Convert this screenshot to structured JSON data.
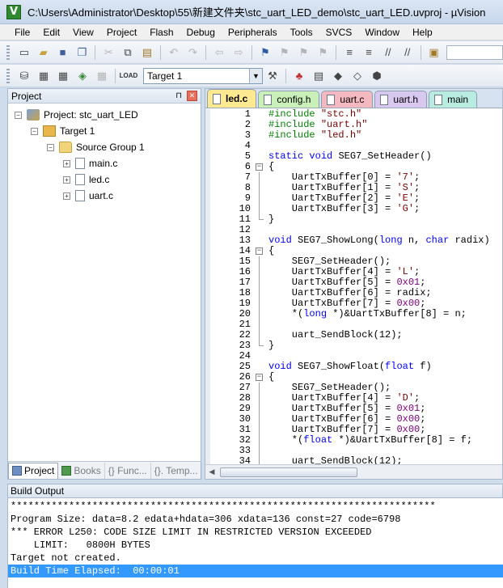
{
  "window": {
    "title": "C:\\Users\\Administrator\\Desktop\\55\\新建文件夹\\stc_uart_LED_demo\\stc_uart_LED.uvproj - µVision",
    "app_icon": "V"
  },
  "menu": [
    "File",
    "Edit",
    "View",
    "Project",
    "Flash",
    "Debug",
    "Peripherals",
    "Tools",
    "SVCS",
    "Window",
    "Help"
  ],
  "toolbar": {
    "target": "Target 1",
    "load_label": "LOAD"
  },
  "project_panel": {
    "title": "Project",
    "pin": "⊓",
    "close": "✕",
    "tree": {
      "project": "Project: stc_uart_LED",
      "target": "Target 1",
      "group": "Source Group 1",
      "files": [
        "main.c",
        "led.c",
        "uart.c"
      ]
    },
    "tabs": [
      "Project",
      "Books",
      "{} Func...",
      "{}. Temp..."
    ]
  },
  "editor": {
    "tabs": [
      {
        "label": "led.c",
        "color": "#ffe990"
      },
      {
        "label": "config.h",
        "color": "#c8f0b8"
      },
      {
        "label": "uart.c",
        "color": "#f4b8c0"
      },
      {
        "label": "uart.h",
        "color": "#d8c8f0"
      },
      {
        "label": "main",
        "color": "#b8ece0"
      }
    ],
    "colors": {
      "keyword": "#0000ff",
      "string": "#800000",
      "number": "#800080",
      "directive": "#008000"
    },
    "lines": [
      {
        "n": "1",
        "f": "",
        "t": [
          [
            "d",
            "#include "
          ],
          [
            "s",
            "\"stc.h\""
          ]
        ]
      },
      {
        "n": "2",
        "f": "",
        "t": [
          [
            "d",
            "#include "
          ],
          [
            "s",
            "\"uart.h\""
          ]
        ]
      },
      {
        "n": "3",
        "f": "",
        "t": [
          [
            "d",
            "#include "
          ],
          [
            "s",
            "\"led.h\""
          ]
        ]
      },
      {
        "n": "4",
        "f": "",
        "t": []
      },
      {
        "n": "5",
        "f": "",
        "t": [
          [
            "k",
            "static "
          ],
          [
            "k",
            "void "
          ],
          [
            "p",
            "SEG7_SetHeader()"
          ]
        ]
      },
      {
        "n": "6",
        "f": "open",
        "t": [
          [
            "p",
            "{"
          ]
        ]
      },
      {
        "n": "7",
        "f": "line",
        "t": [
          [
            "p",
            "    UartTxBuffer[0] = "
          ],
          [
            "s",
            "'7'"
          ],
          [
            "p",
            ";"
          ]
        ]
      },
      {
        "n": "8",
        "f": "line",
        "t": [
          [
            "p",
            "    UartTxBuffer[1] = "
          ],
          [
            "s",
            "'S'"
          ],
          [
            "p",
            ";"
          ]
        ]
      },
      {
        "n": "9",
        "f": "line",
        "t": [
          [
            "p",
            "    UartTxBuffer[2] = "
          ],
          [
            "s",
            "'E'"
          ],
          [
            "p",
            ";"
          ]
        ]
      },
      {
        "n": "10",
        "f": "line",
        "t": [
          [
            "p",
            "    UartTxBuffer[3] = "
          ],
          [
            "s",
            "'G'"
          ],
          [
            "p",
            ";"
          ]
        ]
      },
      {
        "n": "11",
        "f": "end",
        "t": [
          [
            "p",
            "}"
          ]
        ]
      },
      {
        "n": "12",
        "f": "",
        "t": []
      },
      {
        "n": "13",
        "f": "",
        "t": [
          [
            "k",
            "void "
          ],
          [
            "p",
            "SEG7_ShowLong("
          ],
          [
            "k",
            "long "
          ],
          [
            "p",
            "n, "
          ],
          [
            "k",
            "char "
          ],
          [
            "p",
            "radix)"
          ]
        ]
      },
      {
        "n": "14",
        "f": "open",
        "t": [
          [
            "p",
            "{"
          ]
        ]
      },
      {
        "n": "15",
        "f": "line",
        "t": [
          [
            "p",
            "    SEG7_SetHeader();"
          ]
        ]
      },
      {
        "n": "16",
        "f": "line",
        "t": [
          [
            "p",
            "    UartTxBuffer[4] = "
          ],
          [
            "s",
            "'L'"
          ],
          [
            "p",
            ";"
          ]
        ]
      },
      {
        "n": "17",
        "f": "line",
        "t": [
          [
            "p",
            "    UartTxBuffer[5] = "
          ],
          [
            "m",
            "0x01"
          ],
          [
            "p",
            ";"
          ]
        ]
      },
      {
        "n": "18",
        "f": "line",
        "t": [
          [
            "p",
            "    UartTxBuffer[6] = radix;"
          ]
        ]
      },
      {
        "n": "19",
        "f": "line",
        "t": [
          [
            "p",
            "    UartTxBuffer[7] = "
          ],
          [
            "m",
            "0x00"
          ],
          [
            "p",
            ";"
          ]
        ]
      },
      {
        "n": "20",
        "f": "line",
        "t": [
          [
            "p",
            "    *("
          ],
          [
            "k",
            "long "
          ],
          [
            "p",
            "*)&UartTxBuffer[8] = n;"
          ]
        ]
      },
      {
        "n": "21",
        "f": "line",
        "t": []
      },
      {
        "n": "22",
        "f": "line",
        "t": [
          [
            "p",
            "    uart_SendBlock(12);"
          ]
        ]
      },
      {
        "n": "23",
        "f": "end",
        "t": [
          [
            "p",
            "}"
          ]
        ]
      },
      {
        "n": "24",
        "f": "",
        "t": []
      },
      {
        "n": "25",
        "f": "",
        "t": [
          [
            "k",
            "void "
          ],
          [
            "p",
            "SEG7_ShowFloat("
          ],
          [
            "k",
            "float "
          ],
          [
            "p",
            "f)"
          ]
        ]
      },
      {
        "n": "26",
        "f": "open",
        "t": [
          [
            "p",
            "{"
          ]
        ]
      },
      {
        "n": "27",
        "f": "line",
        "t": [
          [
            "p",
            "    SEG7_SetHeader();"
          ]
        ]
      },
      {
        "n": "28",
        "f": "line",
        "t": [
          [
            "p",
            "    UartTxBuffer[4] = "
          ],
          [
            "s",
            "'D'"
          ],
          [
            "p",
            ";"
          ]
        ]
      },
      {
        "n": "29",
        "f": "line",
        "t": [
          [
            "p",
            "    UartTxBuffer[5] = "
          ],
          [
            "m",
            "0x01"
          ],
          [
            "p",
            ";"
          ]
        ]
      },
      {
        "n": "30",
        "f": "line",
        "t": [
          [
            "p",
            "    UartTxBuffer[6] = "
          ],
          [
            "m",
            "0x00"
          ],
          [
            "p",
            ";"
          ]
        ]
      },
      {
        "n": "31",
        "f": "line",
        "t": [
          [
            "p",
            "    UartTxBuffer[7] = "
          ],
          [
            "m",
            "0x00"
          ],
          [
            "p",
            ";"
          ]
        ]
      },
      {
        "n": "32",
        "f": "line",
        "t": [
          [
            "p",
            "    *("
          ],
          [
            "k",
            "float "
          ],
          [
            "p",
            "*)&UartTxBuffer[8] = f;"
          ]
        ]
      },
      {
        "n": "33",
        "f": "line",
        "t": []
      },
      {
        "n": "34",
        "f": "line",
        "t": [
          [
            "p",
            "    uart_SendBlock(12);"
          ]
        ]
      }
    ]
  },
  "build_output": {
    "title": "Build Output",
    "lines": [
      "*************************************************************************",
      "Program Size: data=8.2 edata+hdata=306 xdata=136 const=27 code=6798",
      "*** ERROR L250: CODE SIZE LIMIT IN RESTRICTED VERSION EXCEEDED",
      "    LIMIT:   0800H BYTES",
      "Target not created.",
      "Build Time Elapsed:  00:00:01"
    ]
  }
}
